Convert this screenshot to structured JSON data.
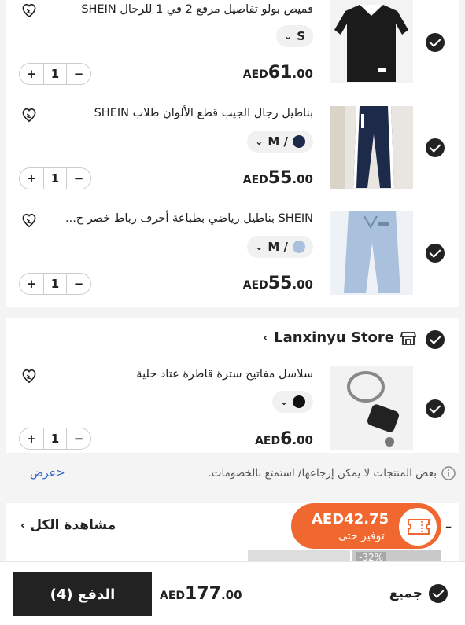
{
  "products": [
    {
      "title": "قميص بولو تفاصيل مرقع 2 في 1 للرجال SHEIN",
      "variant": "S",
      "currency": "AED",
      "price_int": "61",
      "price_dec": ".00",
      "qty": "1",
      "swatch": null
    },
    {
      "title": "بناطيل رجال الجيب قطع الألوان طلاب SHEIN",
      "variant": "M /",
      "currency": "AED",
      "price_int": "55",
      "price_dec": ".00",
      "qty": "1",
      "swatch": "#1d2a4a"
    },
    {
      "title": "SHEIN بناطيل رياضي بطباعة أحرف رباط خصر ح...",
      "variant": "M /",
      "currency": "AED",
      "price_int": "55",
      "price_dec": ".00",
      "qty": "1",
      "swatch": "#a9c1dc"
    }
  ],
  "store": {
    "name": "Lanxinyu Store",
    "product": {
      "title": "سلاسل مفاتيح سترة قاطرة عتاد حلية",
      "currency": "AED",
      "price_int": "6",
      "price_dec": ".00",
      "qty": "1",
      "swatch": "#111111"
    }
  },
  "notice": {
    "text": "بعض المنتجات لا يمكن إرجاعها/ استمتع بالخصومات.",
    "link": "عرض>"
  },
  "recommend": {
    "view_all": "مشاهدة الكل",
    "badge": "-32%"
  },
  "savings": {
    "amount": "AED42.75",
    "label": "توفير حتى"
  },
  "footer": {
    "select_all": "جميع",
    "currency": "AED",
    "total_int": "177",
    "total_dec": ".00",
    "checkout": "الدفع (4)"
  },
  "colors": {
    "accent_orange": "#f0682f",
    "dark": "#222222"
  }
}
